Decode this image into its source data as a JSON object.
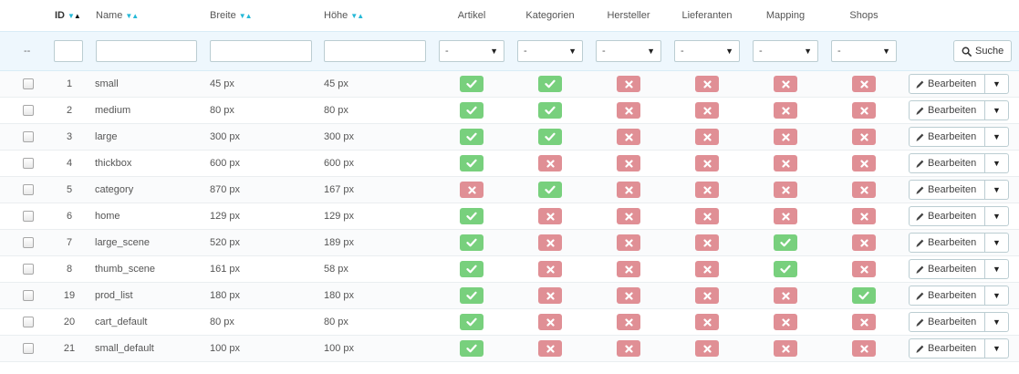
{
  "header": {
    "id": "ID",
    "name": "Name",
    "width": "Breite",
    "height": "Höhe",
    "products": "Artikel",
    "categories": "Kategorien",
    "manufacturers": "Hersteller",
    "suppliers": "Lieferanten",
    "mapping": "Mapping",
    "shops": "Shops"
  },
  "filters": {
    "dash": "--",
    "select_value": "-",
    "search_label": "Suche"
  },
  "actions": {
    "edit_label": "Bearbeiten"
  },
  "colors": {
    "yes": "#78d07d",
    "no": "#e08f95",
    "accent": "#25b9d7"
  },
  "icons": {
    "yes": "check-icon",
    "no": "cross-icon",
    "edit": "pencil-icon",
    "search": "search-icon"
  },
  "rows": [
    {
      "id": "1",
      "name": "small",
      "width": "45 px",
      "height": "45 px",
      "products": true,
      "categories": true,
      "manufacturers": false,
      "suppliers": false,
      "mapping": false,
      "shops": false
    },
    {
      "id": "2",
      "name": "medium",
      "width": "80 px",
      "height": "80 px",
      "products": true,
      "categories": true,
      "manufacturers": false,
      "suppliers": false,
      "mapping": false,
      "shops": false
    },
    {
      "id": "3",
      "name": "large",
      "width": "300 px",
      "height": "300 px",
      "products": true,
      "categories": true,
      "manufacturers": false,
      "suppliers": false,
      "mapping": false,
      "shops": false
    },
    {
      "id": "4",
      "name": "thickbox",
      "width": "600 px",
      "height": "600 px",
      "products": true,
      "categories": false,
      "manufacturers": false,
      "suppliers": false,
      "mapping": false,
      "shops": false
    },
    {
      "id": "5",
      "name": "category",
      "width": "870 px",
      "height": "167 px",
      "products": false,
      "categories": true,
      "manufacturers": false,
      "suppliers": false,
      "mapping": false,
      "shops": false
    },
    {
      "id": "6",
      "name": "home",
      "width": "129 px",
      "height": "129 px",
      "products": true,
      "categories": false,
      "manufacturers": false,
      "suppliers": false,
      "mapping": false,
      "shops": false
    },
    {
      "id": "7",
      "name": "large_scene",
      "width": "520 px",
      "height": "189 px",
      "products": true,
      "categories": false,
      "manufacturers": false,
      "suppliers": false,
      "mapping": true,
      "shops": false
    },
    {
      "id": "8",
      "name": "thumb_scene",
      "width": "161 px",
      "height": "58 px",
      "products": true,
      "categories": false,
      "manufacturers": false,
      "suppliers": false,
      "mapping": true,
      "shops": false
    },
    {
      "id": "19",
      "name": "prod_list",
      "width": "180 px",
      "height": "180 px",
      "products": true,
      "categories": false,
      "manufacturers": false,
      "suppliers": false,
      "mapping": false,
      "shops": true
    },
    {
      "id": "20",
      "name": "cart_default",
      "width": "80 px",
      "height": "80 px",
      "products": true,
      "categories": false,
      "manufacturers": false,
      "suppliers": false,
      "mapping": false,
      "shops": false
    },
    {
      "id": "21",
      "name": "small_default",
      "width": "100 px",
      "height": "100 px",
      "products": true,
      "categories": false,
      "manufacturers": false,
      "suppliers": false,
      "mapping": false,
      "shops": false
    }
  ]
}
